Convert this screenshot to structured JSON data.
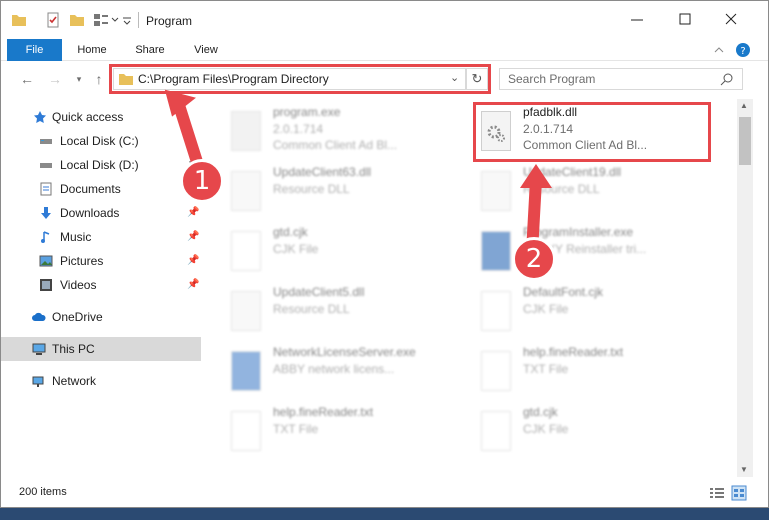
{
  "window": {
    "title": "Program"
  },
  "ribbon": {
    "tabs": [
      "File",
      "Home",
      "Share",
      "View"
    ]
  },
  "address": {
    "path": "C:\\Program Files\\Program Directory"
  },
  "search": {
    "placeholder": "Search Program"
  },
  "sidebar": {
    "items": [
      {
        "label": "Quick access",
        "icon": "star-icon"
      },
      {
        "label": "Local Disk (C:)",
        "icon": "drive-icon"
      },
      {
        "label": "Local Disk (D:)",
        "icon": "drive-icon"
      },
      {
        "label": "Documents",
        "icon": "documents-icon"
      },
      {
        "label": "Downloads",
        "icon": "download-icon"
      },
      {
        "label": "Music",
        "icon": "music-icon"
      },
      {
        "label": "Pictures",
        "icon": "pictures-icon"
      },
      {
        "label": "Videos",
        "icon": "videos-icon"
      },
      {
        "label": "OneDrive",
        "icon": "cloud-icon"
      },
      {
        "label": "This PC",
        "icon": "computer-icon"
      },
      {
        "label": "Network",
        "icon": "network-icon"
      }
    ]
  },
  "files": [
    {
      "name": "program.exe",
      "meta1": "2.0.1.714",
      "meta2": "Common Client Ad Bl..."
    },
    {
      "name": "pfadblk.dll",
      "meta1": "2.0.1.714",
      "meta2": "Common Client Ad Bl..."
    },
    {
      "name": "UpdateClient63.dll",
      "meta1": "Resource DLL",
      "meta2": ""
    },
    {
      "name": "UpdateClient19.dll",
      "meta1": "Resource DLL",
      "meta2": ""
    },
    {
      "name": "gtd.cjk",
      "meta1": "CJK File",
      "meta2": ""
    },
    {
      "name": "ProgramInstaller.exe",
      "meta1": "ABBYY Reinstaller tri...",
      "meta2": ""
    },
    {
      "name": "UpdateClient5.dll",
      "meta1": "Resource DLL",
      "meta2": ""
    },
    {
      "name": "DefaultFont.cjk",
      "meta1": "CJK File",
      "meta2": ""
    },
    {
      "name": "NetworkLicenseServer.exe",
      "meta1": "ABBY network licens...",
      "meta2": ""
    },
    {
      "name": "help.fineReader.txt",
      "meta1": "TXT File",
      "meta2": ""
    },
    {
      "name": "help.fineReader.txt",
      "meta1": "TXT File",
      "meta2": ""
    },
    {
      "name": "gtd.cjk",
      "meta1": "CJK File",
      "meta2": ""
    }
  ],
  "callouts": [
    "1",
    "2"
  ],
  "status": {
    "count": "200 items"
  },
  "colors": {
    "accent": "#1979ca",
    "highlight": "#e6474b"
  }
}
